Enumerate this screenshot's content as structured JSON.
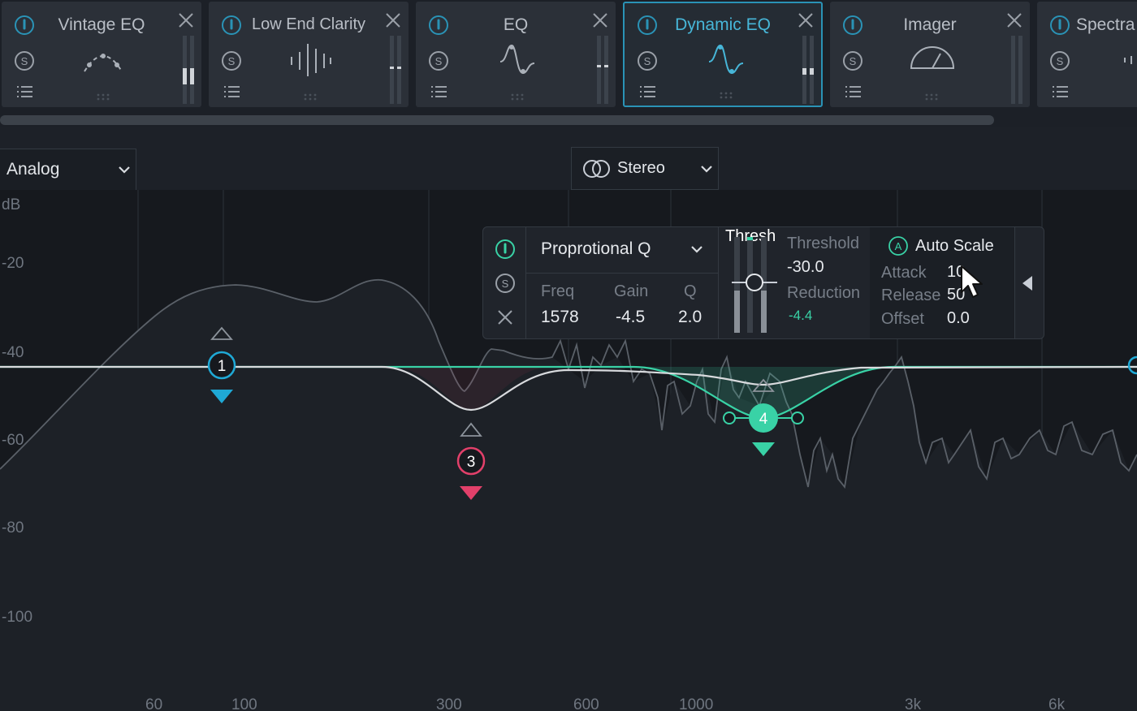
{
  "modules": [
    {
      "title": "Vintage EQ"
    },
    {
      "title": "Low End Clarity"
    },
    {
      "title": "EQ"
    },
    {
      "title": "Dynamic EQ",
      "active": true
    },
    {
      "title": "Imager"
    },
    {
      "title": "Spectra"
    }
  ],
  "toolbar": {
    "mode_value": "Analog",
    "stereo_value": "Stereo"
  },
  "graph": {
    "db_label": "dB",
    "y_ticks": [
      "-20",
      "-40",
      "-60",
      "-80",
      "-100"
    ],
    "x_ticks": [
      "60",
      "100",
      "300",
      "600",
      "1000",
      "3k",
      "6k"
    ],
    "nodes": [
      "1",
      "3",
      "4"
    ]
  },
  "popup": {
    "shape_value": "Proprotional Q",
    "freq_label": "Freq",
    "gain_label": "Gain",
    "q_label": "Q",
    "freq_value": "1578",
    "gain_value": "-4.5",
    "q_value": "2.0",
    "thresh_label": "Thresh",
    "threshold_label": "Threshold",
    "threshold_value": "-30.0",
    "reduction_label": "Reduction",
    "reduction_value": "-4.4",
    "autoscale_label": "Auto Scale",
    "attack_label": "Attack",
    "attack_value": "10",
    "release_label": "Release",
    "release_value": "50",
    "offset_label": "Offset",
    "offset_value": "0.0"
  },
  "colors": {
    "accent": "#2a93b6",
    "band1": "#1fa9d6",
    "band3": "#e2406a",
    "band4": "#39d2a6",
    "curve": "#d8dadd"
  },
  "icons": [
    "power-icon",
    "solo-icon",
    "menu-icon",
    "close-icon",
    "chevron-down-icon",
    "stereo-icon",
    "autoscale-icon",
    "collapse-arrow-icon",
    "cursor-icon"
  ]
}
